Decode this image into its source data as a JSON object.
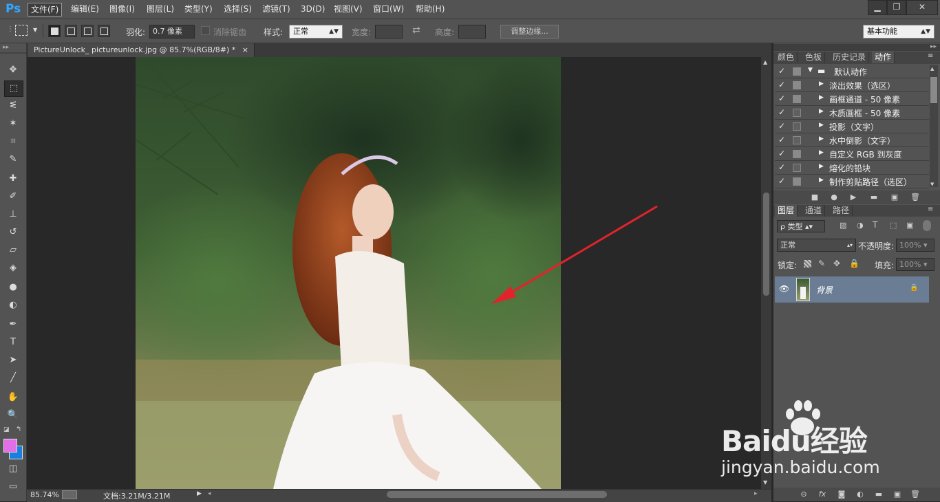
{
  "app": {
    "logo": "Ps"
  },
  "menu": [
    "文件(F)",
    "编辑(E)",
    "图像(I)",
    "图层(L)",
    "类型(Y)",
    "选择(S)",
    "滤镜(T)",
    "3D(D)",
    "视图(V)",
    "窗口(W)",
    "帮助(H)"
  ],
  "window_controls": {
    "minimize": "▁",
    "restore": "❐",
    "close": "✕"
  },
  "options": {
    "feather_label": "羽化:",
    "feather_value": "0.7 像素",
    "antialias_label": "消除锯齿",
    "style_label": "样式:",
    "style_value": "正常",
    "width_label": "宽度:",
    "swap_icon": "⇄",
    "height_label": "高度:",
    "refine_edge": "调整边缘...",
    "workspace": "基本功能"
  },
  "document": {
    "tab_title": "PictureUnlock_ pictureunlock.jpg @ 85.7%(RGB/8#) *",
    "tab_close": "×",
    "zoom": "85.74%",
    "doc_size": "文档:3.21M/3.21M"
  },
  "tools": [
    "move-icon",
    "marquee-icon",
    "lasso-icon",
    "magic-wand-icon",
    "crop-icon",
    "eyedropper-icon",
    "healing-icon",
    "brush-icon",
    "stamp-icon",
    "history-brush-icon",
    "eraser-icon",
    "bucket-icon",
    "blur-icon",
    "dodge-icon",
    "pen-icon",
    "type-icon",
    "path-select-icon",
    "line-icon",
    "hand-icon",
    "zoom-icon"
  ],
  "tool_glyphs": [
    "✥",
    "⬚",
    "ᓬ",
    "✶",
    "⌗",
    "✎",
    "✚",
    "✐",
    "⊥",
    "↺",
    "▱",
    "◈",
    "●",
    "◐",
    "✒",
    "T",
    "➤",
    "╱",
    "✋",
    "🔍"
  ],
  "colors": {
    "foreground": "#e36fe6",
    "background": "#1c7fe0"
  },
  "upper_panel": {
    "tabs": [
      "颜色",
      "色板",
      "历史记录",
      "动作"
    ],
    "active_tab": 3,
    "actions": [
      {
        "label": "默认动作",
        "folder": true,
        "dialog": true
      },
      {
        "label": "淡出效果（选区）",
        "dialog": true
      },
      {
        "label": "画框通道 - 50 像素",
        "dialog": true
      },
      {
        "label": "木质画框 - 50 像素",
        "dialog": false
      },
      {
        "label": "投影（文字）",
        "dialog": false
      },
      {
        "label": "水中倒影（文字）",
        "dialog": false
      },
      {
        "label": "自定义 RGB 到灰度",
        "dialog": true
      },
      {
        "label": "熔化的铅块",
        "dialog": false
      },
      {
        "label": "制作剪贴路径（选区）",
        "dialog": true
      }
    ],
    "footer_icons": [
      "■",
      "●",
      "▶",
      "▬",
      "▣",
      "🗑"
    ]
  },
  "layers_panel": {
    "tabs": [
      "图层",
      "通道",
      "路径"
    ],
    "filter_label": "ρ 类型",
    "blend_mode": "正常",
    "opacity_label": "不透明度:",
    "opacity_value": "100%",
    "lock_label": "锁定:",
    "fill_label": "填充:",
    "fill_value": "100%",
    "layer_name": "背景",
    "footer_icons": [
      "⊝",
      "fx",
      "◙",
      "◐",
      "▬",
      "▣",
      "🗑"
    ]
  },
  "watermark": {
    "brand": "Baidu经验",
    "url": "jingyan.baidu.com"
  }
}
